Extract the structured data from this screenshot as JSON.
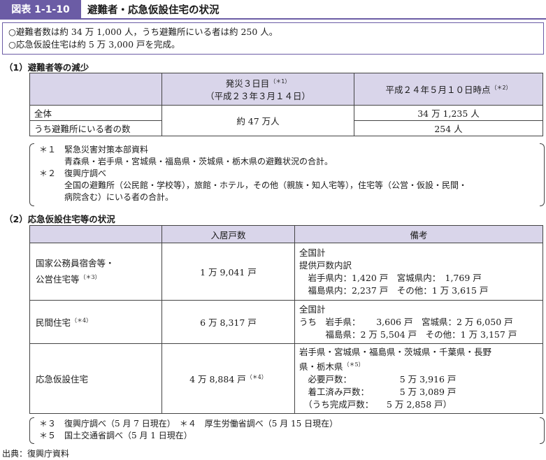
{
  "header": {
    "label": "図表 1-1-10",
    "title": "避難者・応急仮設住宅の状況"
  },
  "summary": [
    "○避難者数は約 34 万 1,000 人，うち避難所にいる者は約 250 人。",
    "○応急仮設住宅は約 5 万 3,000 戸を完成。"
  ],
  "section1": {
    "title": "（1）避難者等の減少",
    "col1": {
      "line1": "発災３日目",
      "note": "（＊1）",
      "line2": "（平成２３年３月１４日）"
    },
    "col2": {
      "text": "平成２４年５月１０日時点",
      "note": "（＊2）"
    },
    "rows": [
      {
        "label": "全体",
        "value2": "34 万 1,235 人"
      },
      {
        "label": "うち避難所にいる者の数",
        "value2": "254 人"
      }
    ],
    "merged_value1": "約 47 万人",
    "notes": [
      "＊１　緊急災害対策本部資料",
      "青森県・岩手県・宮城県・福島県・茨城県・栃木県の避難状況の合計。",
      "＊２　復興庁調べ",
      "全国の避難所（公民館・学校等），旅館・ホテル，その他（親族・知人宅等），住宅等（公営・仮設・民間・",
      "病院含む）にいる者の合計。"
    ]
  },
  "section2": {
    "title": "（2）応急仮設住宅等の状況",
    "headers": [
      "入居戸数",
      "備考"
    ],
    "rows": [
      {
        "label_line1": "国家公務員宿舎等・",
        "label_line2": "公営住宅等",
        "label_note": "（＊3）",
        "count": "1 万 9,041 戸",
        "count_note": "",
        "remarks": [
          "全国計",
          "提供戸数内訳",
          "　岩手県内：1,420 戸　宮城県内：　1,769 戸",
          "　福島県内：2,237 戸　その他：1 万 3,615 戸"
        ]
      },
      {
        "label_line1": "民間住宅",
        "label_line2": "",
        "label_note": "（＊4）",
        "count": "6 万 8,317 戸",
        "count_note": "",
        "remarks": [
          "全国計",
          "うち　岩手県：　　 3,606 戸　宮城県：2 万 6,050 戸",
          "　　　福島県：2 万 5,504 戸　その他：1 万 3,157 戸"
        ]
      },
      {
        "label_line1": "応急仮設住宅",
        "label_line2": "",
        "label_note": "",
        "count": "4 万 8,884 戸",
        "count_note": "（＊4）",
        "remarks": [
          "岩手県・宮城県・福島県・茨城県・千葉県・長野",
          "県・栃木県",
          "　必要戸数：　　　　　　5 万 3,916 戸",
          "　着工済み戸数：　　　　5 万 3,089 戸",
          "　（うち完成戸数：　　5 万 2,858 戸）"
        ],
        "remarks_note": "（＊5）"
      }
    ],
    "notes": [
      "＊３　復興庁調べ（5 月 7 日現在）　＊４　厚生労働省調べ（5 月 15 日現在）",
      "＊５　国土交通省調べ（5 月 1 日現在）"
    ]
  },
  "source": "出典：復興庁資料"
}
